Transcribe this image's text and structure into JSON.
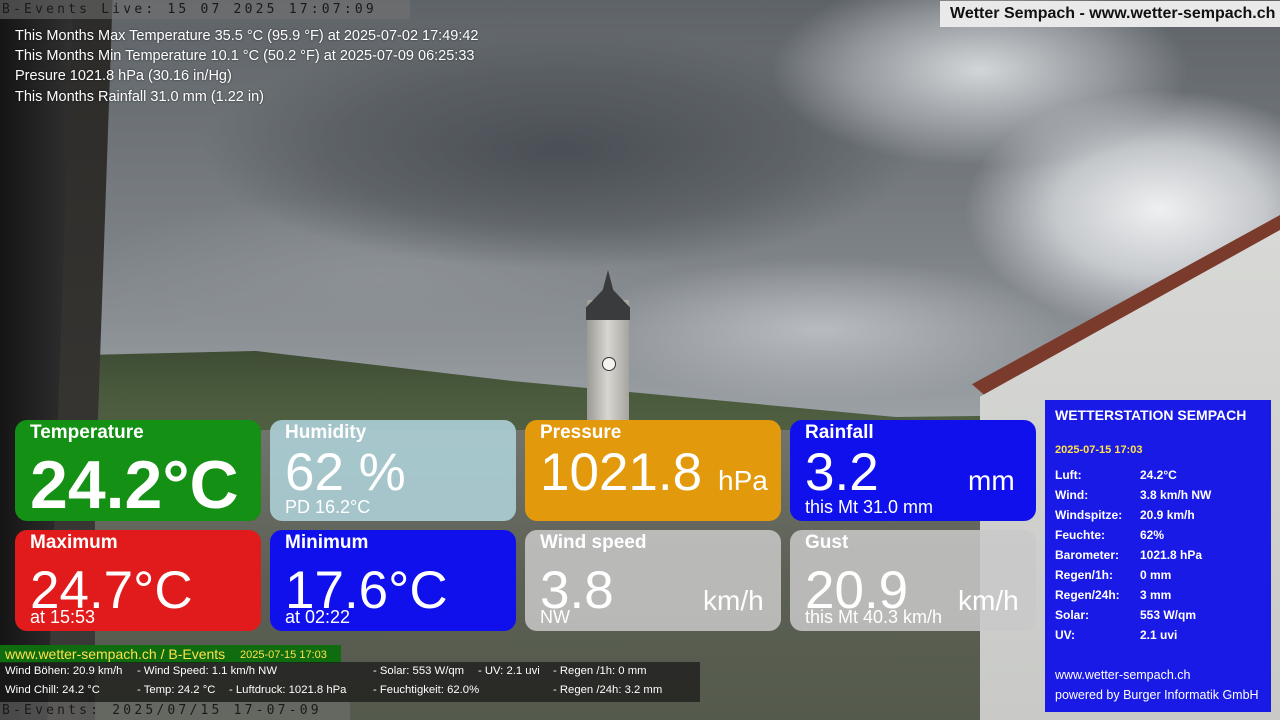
{
  "header": {
    "live_stamp": "B-Events Live: 15 07 2025 17:07:09",
    "brand": "Wetter Sempach - www.wetter-sempach.ch"
  },
  "monthly_stats": [
    "This Months Max Temperature 35.5 °C (95.9 °F) at 2025-07-02 17:49:42",
    "This Months Min Temperature 10.1 °C (50.2 °F) at 2025-07-09 06:25:33",
    "Presure 1021.8 hPa (30.16 in/Hg)",
    "This Months Rainfall 31.0 mm (1.22 in)"
  ],
  "tiles": {
    "temperature": {
      "label": "Temperature",
      "value": "24.2°C",
      "color": "#149014"
    },
    "humidity": {
      "label": "Humidity",
      "value": "62 %",
      "sub": "PD 16.2°C",
      "color": "#aacdd4"
    },
    "pressure": {
      "label": "Pressure",
      "value": "1021.8",
      "unit": "hPa",
      "color": "#e29a0c"
    },
    "rainfall": {
      "label": "Rainfall",
      "value": "3.2",
      "unit": "mm",
      "sub": "this Mt 31.0 mm",
      "color": "#1010ec"
    },
    "maximum": {
      "label": "Maximum",
      "value": "24.7°C",
      "sub": "at 15:53",
      "color": "#e11b1b"
    },
    "minimum": {
      "label": "Minimum",
      "value": "17.6°C",
      "sub": "at 02:22",
      "color": "#1010ec"
    },
    "wind_speed": {
      "label": "Wind speed",
      "value": "3.8",
      "unit": "km/h",
      "sub": "NW",
      "color": "#c8c8c8"
    },
    "gust": {
      "label": "Gust",
      "value": "20.9",
      "unit": "km/h",
      "sub": "this Mt 40.3 km/h",
      "color": "#c8c8c8"
    }
  },
  "panel": {
    "title": "WETTERSTATION SEMPACH",
    "date": "2025-07-15 17:03",
    "rows": [
      {
        "k": "Luft:",
        "v": "24.2°C"
      },
      {
        "k": "Wind:",
        "v": "3.8 km/h  NW"
      },
      {
        "k": "Windspitze:",
        "v": "20.9 km/h"
      },
      {
        "k": "Feuchte:",
        "v": "62%"
      },
      {
        "k": "Barometer:",
        "v": "1021.8 hPa"
      },
      {
        "k": "Regen/1h:",
        "v": "0 mm"
      },
      {
        "k": "Regen/24h:",
        "v": "3 mm"
      },
      {
        "k": "Solar:",
        "v": "553 W/qm"
      },
      {
        "k": "UV:",
        "v": "2.1 uvi"
      }
    ],
    "site": "www.wetter-sempach.ch",
    "powered": "powered by Burger Informatik GmbH"
  },
  "ticker": {
    "site": "www.wetter-sempach.ch / B-Events",
    "date": "2025-07-15 17:03",
    "line1": {
      "a": "Wind Böhen: 20.9 km/h",
      "b": "- Wind Speed: 1.1 km/h NW",
      "c": "- Solar: 553 W/qm",
      "d": "- UV: 2.1 uvi",
      "e": "- Regen /1h:   0 mm"
    },
    "line2": {
      "a": "Wind Chill: 24.2 °C",
      "b": "- Temp: 24.2 °C",
      "c": "- Luftdruck: 1021.8 hPa",
      "d": "- Feuchtigkeit: 62.0%",
      "e": "- Regen /24h: 3.2 mm"
    }
  },
  "footer": {
    "stamp": "B-Events: 2025/07/15 17-07-09"
  }
}
